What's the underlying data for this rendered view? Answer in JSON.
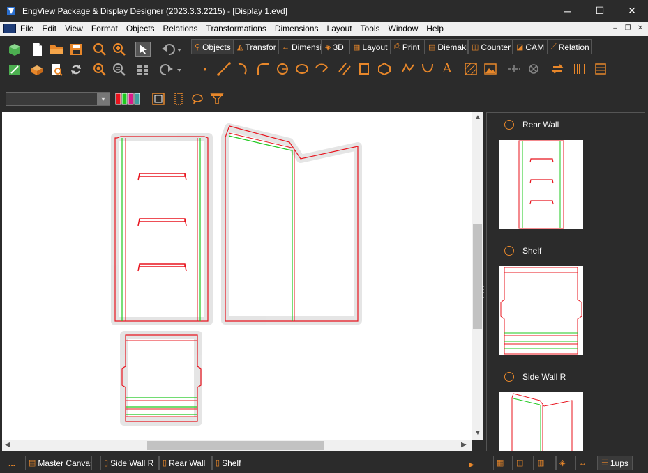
{
  "window": {
    "title": "EngView Package & Display Designer (2023.3.3.2215) - [Display 1.evd]",
    "minimize": "─",
    "maximize": "☐",
    "close": "✕"
  },
  "menu": {
    "items": [
      "File",
      "Edit",
      "View",
      "Format",
      "Objects",
      "Relations",
      "Transformations",
      "Dimensions",
      "Layout",
      "Tools",
      "Window",
      "Help"
    ],
    "mdi_minimize": "‒",
    "mdi_restore": "❐",
    "mdi_close": "✕"
  },
  "tabs": [
    {
      "label": "Objects",
      "icon": "objects-icon",
      "active": true
    },
    {
      "label": "Transfor",
      "icon": "transform-icon"
    },
    {
      "label": "Dimensi",
      "icon": "dimension-icon"
    },
    {
      "label": "3D",
      "icon": "3d-icon"
    },
    {
      "label": "Layout",
      "icon": "layout-icon"
    },
    {
      "label": "Print",
      "icon": "print-icon"
    },
    {
      "label": "Diemaki",
      "icon": "diemaking-icon"
    },
    {
      "label": "Counter",
      "icon": "counter-icon"
    },
    {
      "label": "CAM",
      "icon": "cam-icon"
    },
    {
      "label": "Relation",
      "icon": "relation-icon"
    }
  ],
  "right_panel": {
    "items": [
      {
        "label": "Rear Wall"
      },
      {
        "label": "Shelf"
      },
      {
        "label": "Side Wall R"
      }
    ]
  },
  "bottom_tabs": {
    "more": "...",
    "items": [
      {
        "label": "Master Canvas",
        "icon": "master-canvas-icon"
      },
      {
        "label": "Side Wall R",
        "icon": "document-icon"
      },
      {
        "label": "Rear Wall",
        "icon": "document-icon"
      },
      {
        "label": "Shelf",
        "icon": "document-icon"
      }
    ],
    "ups_label": "1ups"
  },
  "colors": {
    "accent": "#e8872a",
    "cut_line": "#e8141e",
    "crease_line": "#1ec81e",
    "background": "#2b2b2b"
  }
}
